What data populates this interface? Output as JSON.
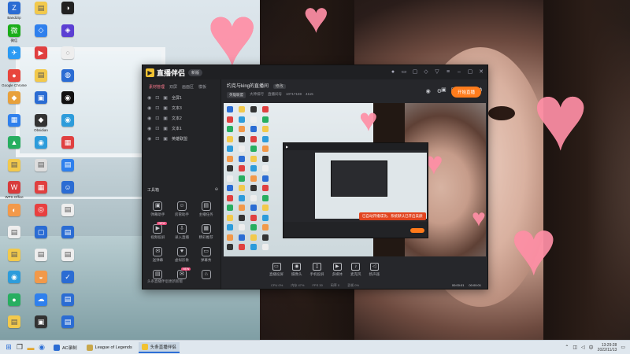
{
  "desktop": {
    "icons": [
      {
        "label": "Bandizip",
        "color": "#2b6cd3",
        "glyph": "Z"
      },
      {
        "label": "微信",
        "color": "#1aad19",
        "glyph": "微"
      },
      {
        "label": "",
        "color": "#2b9af3",
        "glyph": "✈"
      },
      {
        "label": "Google Chrome",
        "color": "#e8453c",
        "glyph": "●"
      },
      {
        "label": "",
        "color": "#e8a13c",
        "glyph": "◆"
      },
      {
        "label": "",
        "color": "#2f80ed",
        "glyph": "▦"
      },
      {
        "label": "",
        "color": "#27ae60",
        "glyph": "▲"
      },
      {
        "label": "",
        "color": "#f2c94c",
        "glyph": "▤"
      },
      {
        "label": "WPS Office",
        "color": "#d83b3b",
        "glyph": "W"
      },
      {
        "label": "",
        "color": "#f2994a",
        "glyph": "◐"
      },
      {
        "label": "",
        "color": "#eeeeee",
        "glyph": "▤"
      },
      {
        "label": "",
        "color": "#f2c94c",
        "glyph": "▤"
      },
      {
        "label": "",
        "color": "#2d9cdb",
        "glyph": "◉"
      },
      {
        "label": "",
        "color": "#27ae60",
        "glyph": "●"
      },
      {
        "label": "",
        "color": "#f2c94c",
        "glyph": "▤"
      },
      {
        "label": "",
        "color": "#f2c94c",
        "glyph": "▤"
      },
      {
        "label": "",
        "color": "#2f80ed",
        "glyph": "◇"
      },
      {
        "label": "",
        "color": "#e04040",
        "glyph": "▶"
      },
      {
        "label": "",
        "color": "#f2c94c",
        "glyph": "▤"
      },
      {
        "label": "",
        "color": "#2b6cd3",
        "glyph": "▣"
      },
      {
        "label": "Obsidian",
        "color": "#333333",
        "glyph": "◆"
      },
      {
        "label": "",
        "color": "#2d9cdb",
        "glyph": "◉"
      },
      {
        "label": "",
        "color": "#dddddd",
        "glyph": "▤"
      },
      {
        "label": "",
        "color": "#e04040",
        "glyph": "▦"
      },
      {
        "label": "",
        "color": "#e84040",
        "glyph": "◎"
      },
      {
        "label": "",
        "color": "#2b6cd3",
        "glyph": "▢"
      },
      {
        "label": "",
        "color": "#eeeeee",
        "glyph": "▤"
      },
      {
        "label": "",
        "color": "#f2994a",
        "glyph": "◒"
      },
      {
        "label": "",
        "color": "#2f80ed",
        "glyph": "☁"
      },
      {
        "label": "",
        "color": "#333333",
        "glyph": "▣"
      },
      {
        "label": "",
        "color": "#222222",
        "glyph": "◑"
      },
      {
        "label": "",
        "color": "#5b3fd3",
        "glyph": "◈"
      },
      {
        "label": "",
        "color": "#eeeeee",
        "glyph": "◌"
      },
      {
        "label": "",
        "color": "#2b6cd3",
        "glyph": "◍"
      },
      {
        "label": "",
        "color": "#111111",
        "glyph": "◉"
      },
      {
        "label": "",
        "color": "#2d9cdb",
        "glyph": "◉"
      },
      {
        "label": "",
        "color": "#e04040",
        "glyph": "▦"
      },
      {
        "label": "",
        "color": "#2f80ed",
        "glyph": "▤"
      },
      {
        "label": "",
        "color": "#2b6cd3",
        "glyph": "☺"
      },
      {
        "label": "",
        "color": "#eeeeee",
        "glyph": "▤"
      },
      {
        "label": "",
        "color": "#2b6cd3",
        "glyph": "▤"
      },
      {
        "label": "",
        "color": "#eeeeee",
        "glyph": "▤"
      },
      {
        "label": "",
        "color": "#2b6cd3",
        "glyph": "✓"
      },
      {
        "label": "",
        "color": "#2b6cd3",
        "glyph": "▤"
      },
      {
        "label": "",
        "color": "#2b6cd3",
        "glyph": "▤"
      }
    ]
  },
  "app": {
    "title": "直播伴侣",
    "version_pill": "新版",
    "sidebar": {
      "tabs": [
        "素材管理",
        "双屏",
        "画面区",
        "模板"
      ],
      "scenes": [
        {
          "label": "全屏1"
        },
        {
          "label": "文本3"
        },
        {
          "label": "文本2"
        },
        {
          "label": "文本1"
        },
        {
          "label": "英雄联盟"
        }
      ],
      "tools_heading": "工具箱",
      "tools": [
        {
          "label": "弹幕助手",
          "icon": "▣",
          "badge": ""
        },
        {
          "label": "房管助手",
          "icon": "☺",
          "badge": ""
        },
        {
          "label": "主播任务",
          "icon": "▤",
          "badge": ""
        },
        {
          "label": "视频投屏",
          "icon": "▶",
          "badge": "NEW"
        },
        {
          "label": "录入直播",
          "icon": "⇩",
          "badge": ""
        },
        {
          "label": "精彩推荐",
          "icon": "▦",
          "badge": ""
        },
        {
          "label": "送弹幕",
          "icon": "✉",
          "badge": ""
        },
        {
          "label": "虚拟形象",
          "icon": "♥",
          "badge": ""
        },
        {
          "label": "弹幕秀",
          "icon": "▭",
          "badge": ""
        },
        {
          "label": "",
          "icon": "▤",
          "badge": ""
        },
        {
          "label": "",
          "icon": "✉",
          "badge": "NEW"
        },
        {
          "label": "",
          "icon": "⌂",
          "badge": ""
        }
      ],
      "footer": "头条直播伴侣更新新版"
    },
    "room": {
      "title": "约克与king的直播间",
      "edit_hint": "修改",
      "meta_tag": "英雄联盟",
      "meta_items": [
        "大神排行",
        "直播间号",
        "10717159",
        "4115"
      ]
    },
    "preview_toast": "已自动开播成功，系统默认已开启美颜",
    "toolbar": {
      "buttons": [
        {
          "label": "直播投屏",
          "icon": "▭"
        },
        {
          "label": "摄像头",
          "icon": "◉"
        },
        {
          "label": "手机投屏",
          "icon": "▯"
        },
        {
          "label": "多媒体",
          "icon": "▶"
        },
        {
          "label": "麦克风",
          "icon": "♪"
        },
        {
          "label": "扬声器",
          "icon": "◁"
        }
      ],
      "go_live": "开始直播"
    },
    "status": {
      "items": [
        "CPU 0%",
        "内存 47%",
        "FPS 30",
        "码率 0",
        "丢帧 0%"
      ],
      "time_1": "00:00:01",
      "time_2": "00:00:01"
    }
  },
  "taskbar": {
    "apps": [
      {
        "label": "AC录制",
        "color": "#2b6cd3"
      },
      {
        "label": "League of Legends",
        "color": "#c8a74a"
      },
      {
        "label": "头条直播伴侣",
        "color": "#f1c232"
      }
    ],
    "time": "13:29:28",
    "date": "2022/11/13"
  }
}
